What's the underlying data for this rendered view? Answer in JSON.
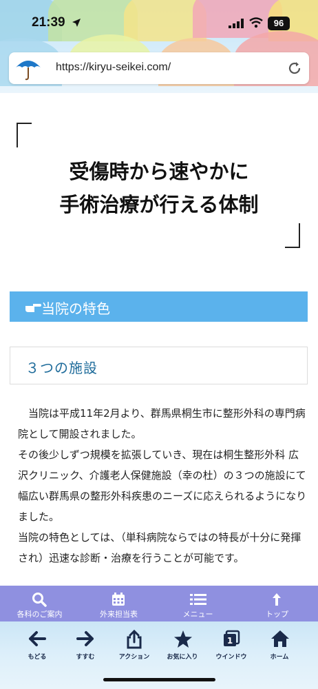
{
  "status": {
    "time": "21:39",
    "battery": "96"
  },
  "browser": {
    "url": "https://kiryu-seikei.com/"
  },
  "hero": {
    "title_line1": "受傷時から速やかに",
    "title_line2": "手術治療が行える体制"
  },
  "features": {
    "heading": "当院の特色"
  },
  "facility": {
    "heading": "３つの施設"
  },
  "body": {
    "paragraph1": "　当院は平成11年2月より、群馬県桐生市に整形外科の専門病院として開設されました。",
    "paragraph2": "その後少しずつ規模を拡張していき、現在は桐生整形外科 広沢クリニック、介護老人保健施設（幸の杜）の３つの施設にて幅広い群馬県の整形外科疾患のニーズに応えられるようになりました。",
    "paragraph3": "当院の特色としては、（単科病院ならではの特長が十分に発揮され）迅速な診断・治療を行うことが可能です。"
  },
  "site_nav": {
    "items": [
      {
        "label": "各科のご案内",
        "icon": "search-icon"
      },
      {
        "label": "外来担当表",
        "icon": "calendar-icon"
      },
      {
        "label": "メニュー",
        "icon": "menu-icon"
      },
      {
        "label": "トップ",
        "icon": "arrow-up-icon"
      }
    ]
  },
  "toolbar": {
    "items": [
      {
        "label": "もどる",
        "icon": "arrow-left-icon"
      },
      {
        "label": "すすむ",
        "icon": "arrow-right-icon"
      },
      {
        "label": "アクション",
        "icon": "share-icon"
      },
      {
        "label": "お気に入り",
        "icon": "star-icon"
      },
      {
        "label": "ウインドウ",
        "icon": "window-icon"
      },
      {
        "label": "ホーム",
        "icon": "home-icon"
      }
    ],
    "window_count": "1"
  },
  "colors": {
    "feature_bar": "#5bb2ec",
    "facility_text": "#1f6c9b",
    "site_nav_bg": "#8f90e0"
  }
}
